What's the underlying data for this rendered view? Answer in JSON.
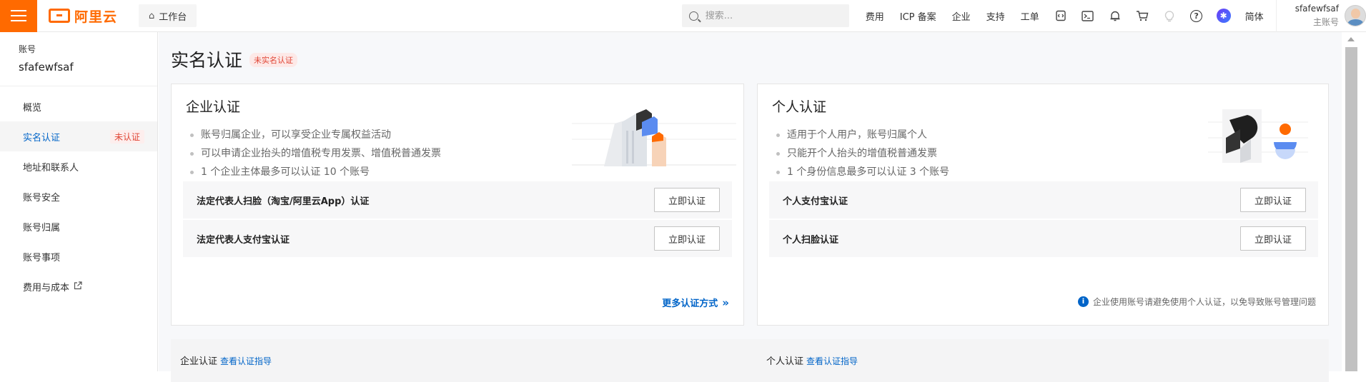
{
  "header": {
    "logo_text": "阿里云",
    "workbench_label": "工作台",
    "search_placeholder": "搜索...",
    "links": [
      "费用",
      "ICP 备案",
      "企业",
      "支持",
      "工单"
    ],
    "lang": "简体",
    "user_name": "sfafewfsaf",
    "user_type": "主账号"
  },
  "sidebar": {
    "account_label": "账号",
    "account_name": "sfafewfsaf",
    "items": [
      {
        "label": "概览"
      },
      {
        "label": "实名认证",
        "tag": "未认证"
      },
      {
        "label": "地址和联系人"
      },
      {
        "label": "账号安全"
      },
      {
        "label": "账号归属"
      },
      {
        "label": "账号事项"
      },
      {
        "label": "费用与成本"
      }
    ]
  },
  "page": {
    "title": "实名认证",
    "status_badge": "未实名认证"
  },
  "enterprise": {
    "title": "企业认证",
    "bullets": [
      "账号归属企业，可以享受企业专属权益活动",
      "可以申请企业抬头的增值税专用发票、增值税普通发票",
      "1 个企业主体最多可以认证 10 个账号"
    ],
    "options": [
      {
        "label": "法定代表人扫脸（淘宝/阿里云App）认证",
        "button": "立即认证"
      },
      {
        "label": "法定代表人支付宝认证",
        "button": "立即认证"
      }
    ],
    "more_link": "更多认证方式"
  },
  "personal": {
    "title": "个人认证",
    "bullets": [
      "适用于个人用户，账号归属个人",
      "只能开个人抬头的增值税普通发票",
      "1 个身份信息最多可以认证 3 个账号"
    ],
    "options": [
      {
        "label": "个人支付宝认证",
        "button": "立即认证"
      },
      {
        "label": "个人扫脸认证",
        "button": "立即认证"
      }
    ],
    "tip": "企业使用账号请避免使用个人认证，以免导致账号管理问题"
  },
  "guides": {
    "enterprise_title": "企业认证",
    "enterprise_link": "查看认证指导",
    "personal_title": "个人认证",
    "personal_link": "查看认证指导"
  },
  "colors": {
    "brand": "#ff6a00",
    "link": "#0064c8",
    "danger": "#e04535"
  }
}
